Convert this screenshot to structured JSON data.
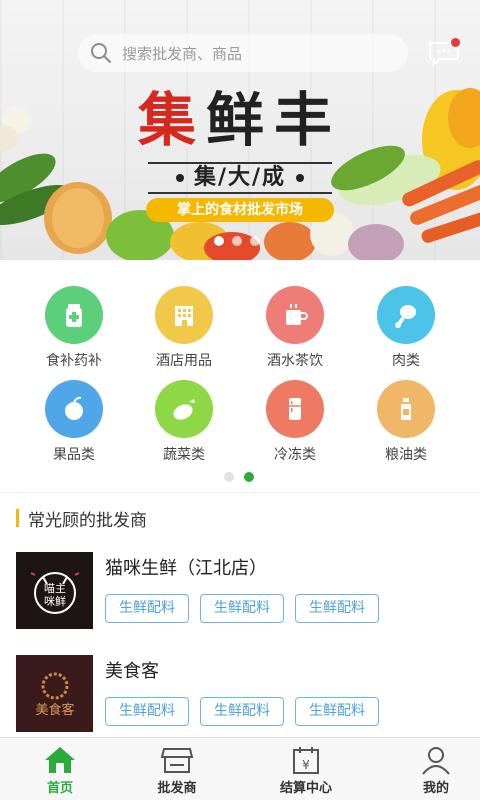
{
  "banner": {
    "search_placeholder": "搜索批发商、商品",
    "brand_char1": "集",
    "brand_char2": "鲜",
    "brand_char3": "丰",
    "brand_sub": "集/大/成",
    "tagline": "掌上的食材批发市场",
    "slide_count": 3,
    "active_slide": 0
  },
  "categories": [
    {
      "label": "食补药补",
      "icon": "medicine-bottle-icon",
      "color": "#5ccf7a"
    },
    {
      "label": "酒店用品",
      "icon": "hotel-building-icon",
      "color": "#f2c84b"
    },
    {
      "label": "酒水茶饮",
      "icon": "tea-cup-icon",
      "color": "#ee7d78"
    },
    {
      "label": "肉类",
      "icon": "drumstick-icon",
      "color": "#4cc3e8"
    },
    {
      "label": "果品类",
      "icon": "apple-icon",
      "color": "#4fa7e8"
    },
    {
      "label": "蔬菜类",
      "icon": "eggplant-icon",
      "color": "#8fd845"
    },
    {
      "label": "冷冻类",
      "icon": "fridge-icon",
      "color": "#ef7a64"
    },
    {
      "label": "粮油类",
      "icon": "oil-bottle-icon",
      "color": "#f0b768"
    }
  ],
  "category_pages": 2,
  "category_active_page": 1,
  "section": {
    "title": "常光顾的批发商"
  },
  "merchants": [
    {
      "name": "猫咪生鲜（江北店）",
      "logo_text": "喵主\n咪鲜",
      "logo_bg": "#1d1414",
      "tags": [
        "生鲜配料",
        "生鲜配料",
        "生鲜配料"
      ]
    },
    {
      "name": "美食客",
      "logo_text": "美食客",
      "logo_bg": "#3a1a1a",
      "tags": [
        "生鲜配料",
        "生鲜配料",
        "生鲜配料"
      ]
    }
  ],
  "nav": [
    {
      "label": "首页",
      "icon": "home-icon",
      "active": true
    },
    {
      "label": "批发商",
      "icon": "store-icon",
      "active": false
    },
    {
      "label": "结算中心",
      "icon": "calendar-yen-icon",
      "active": false
    },
    {
      "label": "我的",
      "icon": "user-icon",
      "active": false
    }
  ],
  "colors": {
    "accent": "#2cab3d",
    "brand_red": "#d5281f",
    "tag_yellow": "#f5b800",
    "tag_blue": "#4ba1dc"
  }
}
